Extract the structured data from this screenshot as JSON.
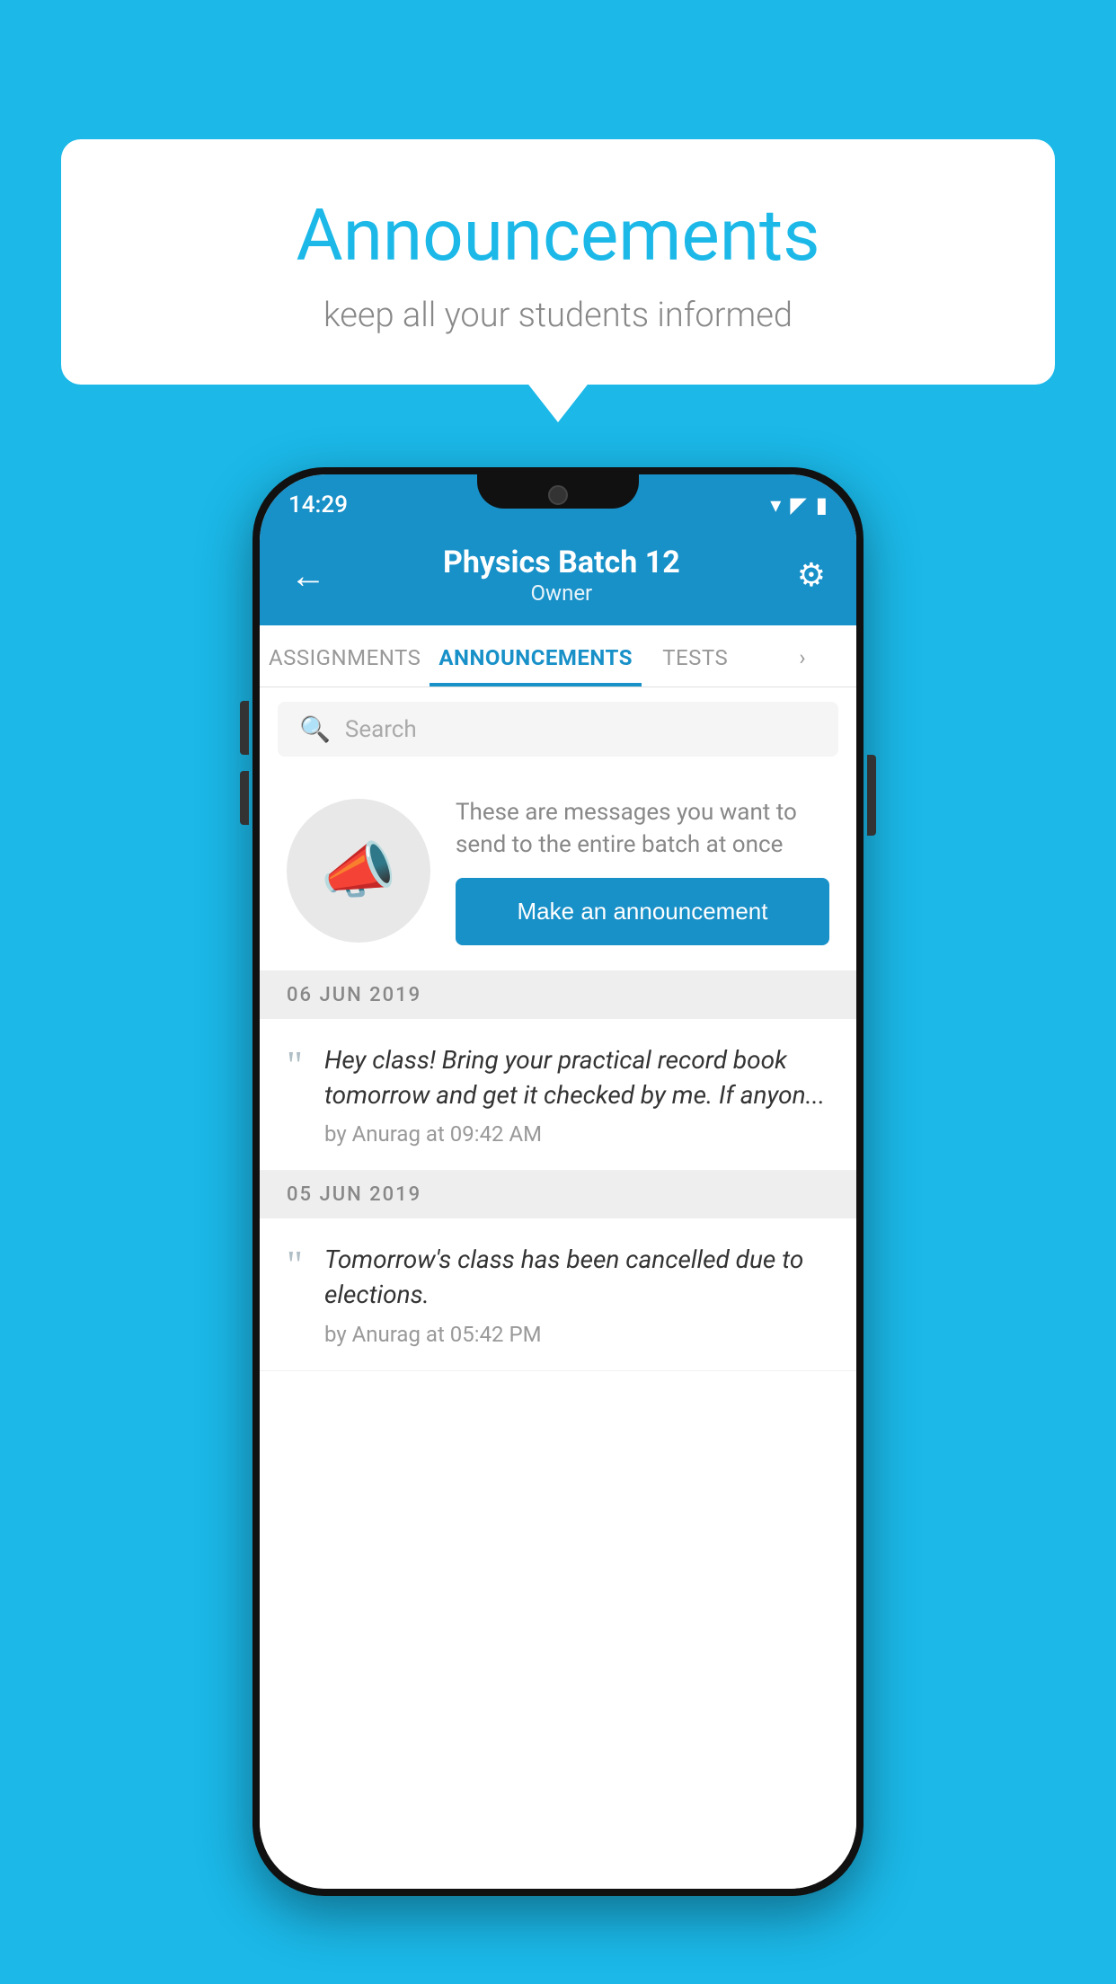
{
  "background_color": "#1bb8e8",
  "speech_bubble": {
    "title": "Announcements",
    "subtitle": "keep all your students informed"
  },
  "phone": {
    "status_bar": {
      "time": "14:29",
      "wifi": "▾",
      "signal": "▲",
      "battery": "▮"
    },
    "header": {
      "back_label": "←",
      "title": "Physics Batch 12",
      "subtitle": "Owner",
      "gear_label": "⚙"
    },
    "tabs": [
      {
        "label": "ASSIGNMENTS",
        "active": false
      },
      {
        "label": "ANNOUNCEMENTS",
        "active": true
      },
      {
        "label": "TESTS",
        "active": false
      },
      {
        "label": "›",
        "active": false
      }
    ],
    "search": {
      "placeholder": "Search"
    },
    "announcement_prompt": {
      "icon_label": "📣",
      "description": "These are messages you want to send to the entire batch at once",
      "button_label": "Make an announcement"
    },
    "date_groups": [
      {
        "date": "06  JUN  2019",
        "items": [
          {
            "text": "Hey class! Bring your practical record book tomorrow and get it checked by me. If anyon...",
            "meta": "by Anurag at 09:42 AM"
          }
        ]
      },
      {
        "date": "05  JUN  2019",
        "items": [
          {
            "text": "Tomorrow's class has been cancelled due to elections.",
            "meta": "by Anurag at 05:42 PM"
          }
        ]
      }
    ]
  }
}
